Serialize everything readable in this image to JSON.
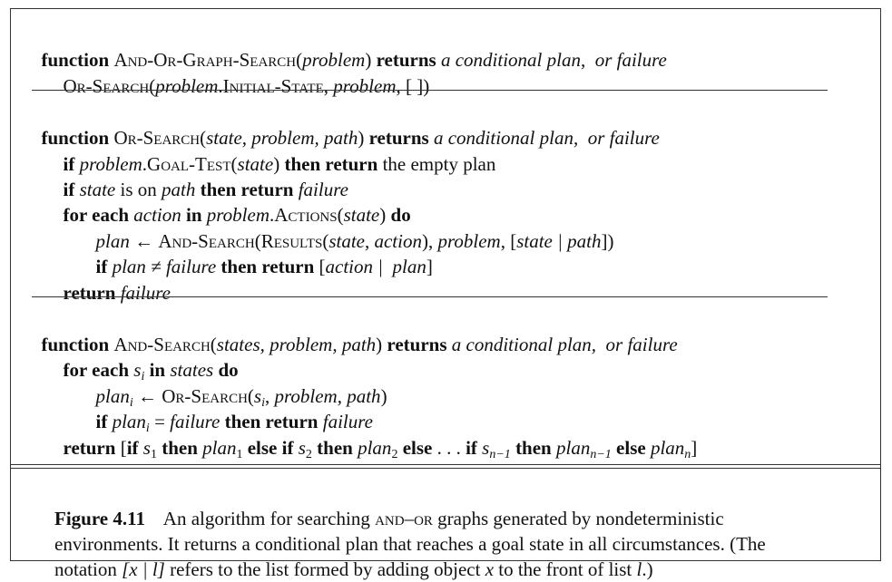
{
  "kw": {
    "if": "if",
    "then": "then",
    "then_return": "then return",
    "for_each": "for each",
    "in": "in",
    "do": "do",
    "return": "return",
    "else": "else",
    "else_if": "else if"
  },
  "algo1": {
    "kw_function": "function",
    "name": "And-Or-Graph-Search",
    "param": "problem",
    "kw_returns": "returns",
    "ret": "a conditional plan,  or failure",
    "body_fn": "Or-Search",
    "body_arg1": "problem",
    "body_attr": "Initial-State",
    "body_arg2": "problem"
  },
  "algo2": {
    "kw_function": "function",
    "name": "Or-Search",
    "params": "state, problem, path",
    "kw_returns": "returns",
    "ret": "a conditional plan,  or failure",
    "l1_obj": "problem",
    "l1_fn": "Goal-Test",
    "l1_arg": "state",
    "l1_tail": "the empty plan",
    "l2_a": "state",
    "l2_mid": "is on",
    "l2_b": "path",
    "l2_c": "failure",
    "l3_var": "action",
    "l3_obj": "problem",
    "l3_fn": "Actions",
    "l3_arg": "state",
    "l4_lhs": "plan",
    "l4_fn": "And-Search",
    "l4_fn2": "Results",
    "l4_args": "state, action",
    "l4_arg2": "problem",
    "l4_arg3": "state | path",
    "l5_cond": "plan ≠ failure",
    "l5_list": "action |  plan",
    "l6_val": "failure"
  },
  "algo3": {
    "kw_function": "function",
    "name": "And-Search",
    "params": "states, problem, path",
    "kw_returns": "returns",
    "ret": "a conditional plan,  or failure",
    "s": "s",
    "i": "i",
    "plan": "plan",
    "l1_states": "states",
    "l2_fn": "Or-Search",
    "l2_rest": "problem, path",
    "l3_fail": "failure",
    "n1": "1",
    "n2": "2",
    "nm1": "n−1",
    "n": "n"
  },
  "caption": {
    "label": "Figure 4.11",
    "line1a": "An algorithm for searching ",
    "line1_sc": "and–or",
    "line1b": " graphs generated by nondeterministic",
    "line2": "environments. It returns a conditional plan that reaches a goal state in all circumstances. (The",
    "line3a": "notation ",
    "line3_note": "[x | l]",
    "line3b": " refers to the list formed by adding object ",
    "var_x": "x",
    "line3c": " to the front of list ",
    "var_l": "l",
    "line3d": ".)"
  }
}
